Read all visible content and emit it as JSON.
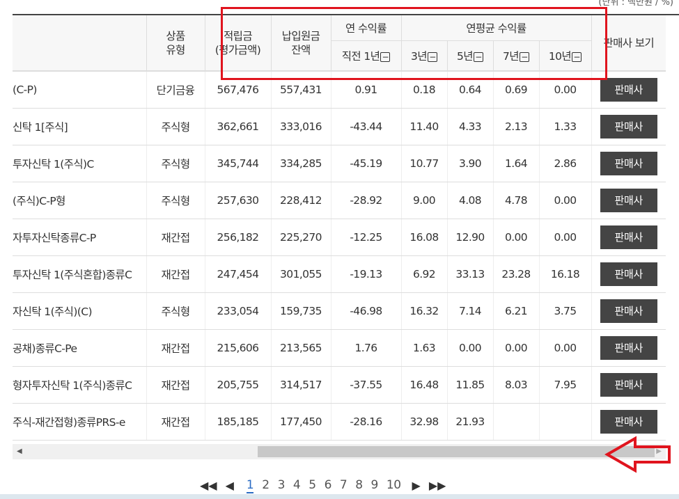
{
  "unit_text": "(단위 : 백만원 / %)",
  "headers": {
    "name": "",
    "type": "상품\n유형",
    "accum": "적립금\n(평가금액)",
    "paid": "납입원금\n잔액",
    "annual_group": "연 수익률",
    "annual_prev": "직전 1년",
    "avg_group": "연평균 수익률",
    "y3": "3년",
    "y5": "5년",
    "y7": "7년",
    "y10": "10년",
    "seller": "판매사 보기"
  },
  "rows": [
    {
      "name": "(C-P)",
      "type": "단기금융",
      "accum": "567,476",
      "paid": "557,431",
      "r1": "0.91",
      "r3": "0.18",
      "r5": "0.64",
      "r7": "0.69",
      "r10": "0.00",
      "btn": "판매사"
    },
    {
      "name": "신탁 1[주식]",
      "type": "주식형",
      "accum": "362,661",
      "paid": "333,016",
      "r1": "-43.44",
      "r3": "11.40",
      "r5": "4.33",
      "r7": "2.13",
      "r10": "1.33",
      "btn": "판매사"
    },
    {
      "name": "투자신탁 1(주식)C",
      "type": "주식형",
      "accum": "345,744",
      "paid": "334,285",
      "r1": "-45.19",
      "r3": "10.77",
      "r5": "3.90",
      "r7": "1.64",
      "r10": "2.86",
      "btn": "판매사"
    },
    {
      "name": "(주식)C-P형",
      "type": "주식형",
      "accum": "257,630",
      "paid": "228,412",
      "r1": "-28.92",
      "r3": "9.00",
      "r5": "4.08",
      "r7": "4.78",
      "r10": "0.00",
      "btn": "판매사"
    },
    {
      "name": "자투자신탁종류C-P",
      "type": "재간접",
      "accum": "256,182",
      "paid": "225,270",
      "r1": "-12.25",
      "r3": "16.08",
      "r5": "12.90",
      "r7": "0.00",
      "r10": "0.00",
      "btn": "판매사"
    },
    {
      "name": "투자신탁 1(주식혼합)종류C",
      "type": "재간접",
      "accum": "247,454",
      "paid": "301,055",
      "r1": "-19.13",
      "r3": "6.92",
      "r5": "33.13",
      "r7": "23.28",
      "r10": "16.18",
      "btn": "판매사"
    },
    {
      "name": "자신탁 1(주식)(C)",
      "type": "주식형",
      "accum": "233,054",
      "paid": "159,735",
      "r1": "-46.98",
      "r3": "16.32",
      "r5": "7.14",
      "r7": "6.21",
      "r10": "3.75",
      "btn": "판매사"
    },
    {
      "name": "공채)종류C-Pe",
      "type": "재간접",
      "accum": "215,606",
      "paid": "213,565",
      "r1": "1.76",
      "r3": "1.63",
      "r5": "0.00",
      "r7": "0.00",
      "r10": "0.00",
      "btn": "판매사"
    },
    {
      "name": "형자투자신탁 1(주식)종류C",
      "type": "재간접",
      "accum": "205,755",
      "paid": "314,517",
      "r1": "-37.55",
      "r3": "16.48",
      "r5": "11.85",
      "r7": "8.03",
      "r10": "7.95",
      "btn": "판매사"
    },
    {
      "name": "주식-재간접형)종류PRS-e",
      "type": "재간접",
      "accum": "185,185",
      "paid": "177,450",
      "r1": "-28.16",
      "r3": "32.98",
      "r5": "21.93",
      "r7": "",
      "r10": "",
      "btn": "판매사"
    }
  ],
  "pagination": {
    "pages": [
      "1",
      "2",
      "3",
      "4",
      "5",
      "6",
      "7",
      "8",
      "9",
      "10"
    ],
    "current": "1"
  },
  "colors": {
    "highlight": "#e0141e",
    "button_bg": "#444444",
    "active_page": "#2b6cc4"
  }
}
